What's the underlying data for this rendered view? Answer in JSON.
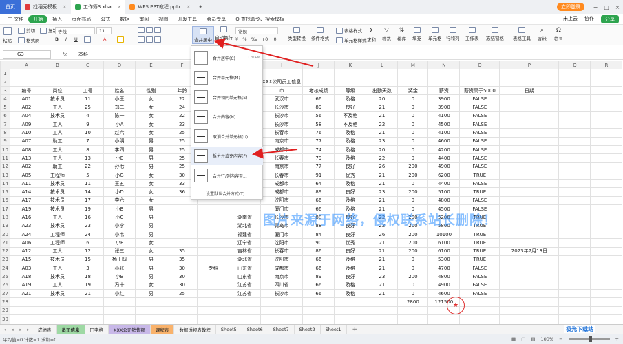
{
  "titlebar": {
    "tabs": [
      {
        "label": "首页",
        "kind": "home",
        "icon_color": ""
      },
      {
        "label": "找稻壳模板",
        "kind": "tab",
        "icon_color": "#e03a3a"
      },
      {
        "label": "工作簿3.xlsx",
        "kind": "active",
        "icon_color": "#2ea44f"
      },
      {
        "label": "WPS PPT教程.pptx",
        "kind": "tab",
        "icon_color": "#ff8a1e"
      }
    ],
    "login": "立即登录"
  },
  "menubar": {
    "items": [
      "三 文件",
      "开始",
      "插入",
      "页面布局",
      "公式",
      "数据",
      "审阅",
      "视图",
      "开发工具",
      "会员专享",
      "Q 查找命令、搜索模板"
    ],
    "right": [
      "未上云",
      "协作"
    ],
    "share": "分享"
  },
  "ribbon": {
    "cut": "剪切",
    "copy": "复制",
    "painter": "格式刷",
    "paste": "粘贴",
    "font": "等线",
    "size": "11",
    "merge": "合并居中",
    "wrap": "自动换行",
    "numfmt": "常规",
    "table_style": "表格样式",
    "cell_style": "单元格样式",
    "cond": "条件格式",
    "sum": "求和",
    "filter": "筛选",
    "sort": "排序",
    "fill": "填充",
    "cell": "单元格",
    "rowcol": "行和列",
    "sheet": "工作表",
    "freeze": "冻结窗格",
    "tabletools": "表格工具",
    "find": "查找",
    "symbol": "符号",
    "type_convert": "类型转换"
  },
  "formula": {
    "cell": "G3",
    "fx": "fx",
    "content": "本科"
  },
  "sheet": {
    "columns": [
      "A",
      "B",
      "C",
      "D",
      "E",
      "F",
      "G",
      "H",
      "I",
      "J",
      "K",
      "L",
      "M",
      "N",
      "O",
      "P",
      "Q",
      "R"
    ],
    "row2_title": "XXX公司员工信息",
    "headers": [
      "编号",
      "岗位",
      "工号",
      "姓名",
      "性别",
      "年龄",
      "",
      "",
      "市",
      "考核成绩",
      "等级",
      "出勤天数",
      "奖金",
      "薪资",
      "薪资高于5000",
      "日期"
    ],
    "rows": [
      [
        "A01",
        "技术员",
        "11",
        "小王",
        "女",
        "22",
        "",
        "",
        "武汉市",
        "66",
        "及格",
        "20",
        "0",
        "3900",
        "FALSE",
        ""
      ],
      [
        "A02",
        "工人",
        "25",
        "郑二",
        "女",
        "24",
        "",
        "",
        "长沙市",
        "89",
        "良好",
        "21",
        "0",
        "3900",
        "FALSE",
        ""
      ],
      [
        "A04",
        "技术员",
        "4",
        "陈一",
        "女",
        "22",
        "",
        "",
        "长沙市",
        "56",
        "不及格",
        "21",
        "0",
        "4100",
        "FALSE",
        ""
      ],
      [
        "A09",
        "工人",
        "9",
        "小A",
        "女",
        "23",
        "",
        "",
        "长沙市",
        "58",
        "不及格",
        "22",
        "0",
        "4500",
        "FALSE",
        ""
      ],
      [
        "A10",
        "工人",
        "10",
        "赵六",
        "女",
        "25",
        "",
        "",
        "长春市",
        "76",
        "及格",
        "21",
        "0",
        "4100",
        "FALSE",
        ""
      ],
      [
        "A07",
        "助工",
        "7",
        "小明",
        "男",
        "25",
        "",
        "",
        "南京市",
        "77",
        "及格",
        "23",
        "0",
        "4600",
        "FALSE",
        ""
      ],
      [
        "A08",
        "工人",
        "8",
        "李四",
        "男",
        "25",
        "",
        "",
        "成都市",
        "74",
        "及格",
        "20",
        "0",
        "4200",
        "FALSE",
        ""
      ],
      [
        "A13",
        "工人",
        "13",
        "小E",
        "男",
        "25",
        "",
        "",
        "长春市",
        "79",
        "及格",
        "22",
        "0",
        "4400",
        "FALSE",
        ""
      ],
      [
        "A02",
        "助工",
        "22",
        "孙七",
        "男",
        "25",
        "",
        "",
        "南京市",
        "77",
        "良好",
        "26",
        "200",
        "4900",
        "FALSE",
        ""
      ],
      [
        "A05",
        "工程师",
        "5",
        "小G",
        "女",
        "30",
        "",
        "",
        "长春市",
        "91",
        "优秀",
        "21",
        "200",
        "6200",
        "TRUE",
        ""
      ],
      [
        "A11",
        "技术员",
        "11",
        "王五",
        "女",
        "33",
        "",
        "",
        "成都市",
        "64",
        "及格",
        "21",
        "0",
        "4400",
        "FALSE",
        ""
      ],
      [
        "A14",
        "技术员",
        "14",
        "小D",
        "女",
        "36",
        "",
        "",
        "成都市",
        "89",
        "良好",
        "23",
        "200",
        "5100",
        "TRUE",
        ""
      ],
      [
        "A17",
        "技术员",
        "17",
        "李六",
        "女",
        "",
        "",
        "",
        "沈阳市",
        "66",
        "及格",
        "21",
        "0",
        "4800",
        "FALSE",
        ""
      ],
      [
        "A19",
        "技术员",
        "19",
        "小B",
        "男",
        "",
        "",
        "",
        "厦门市",
        "66",
        "及格",
        "21",
        "0",
        "4500",
        "FALSE",
        ""
      ],
      [
        "A16",
        "工人",
        "16",
        "小C",
        "男",
        "",
        "",
        "湖南省",
        "长沙市",
        "88",
        "良好",
        "22",
        "200",
        "5200",
        "TRUE",
        ""
      ],
      [
        "A23",
        "技术员",
        "23",
        "小李",
        "男",
        "",
        "",
        "湖北省",
        "青岛市",
        "88",
        "良好",
        "22",
        "200",
        "5800",
        "TRUE",
        ""
      ],
      [
        "A24",
        "工程师",
        "24",
        "小韦",
        "男",
        "",
        "",
        "福建省",
        "厦门市",
        "84",
        "良好",
        "26",
        "200",
        "10100",
        "TRUE",
        ""
      ],
      [
        "A06",
        "工程师",
        "6",
        "小F",
        "女",
        "",
        "",
        "辽宁省",
        "沈阳市",
        "90",
        "优秀",
        "21",
        "200",
        "6100",
        "TRUE",
        ""
      ],
      [
        "A12",
        "工人",
        "12",
        "张三",
        "女",
        "35",
        "",
        "吉林省",
        "长春市",
        "86",
        "良好",
        "21",
        "200",
        "6100",
        "TRUE",
        "2023年7月13日"
      ],
      [
        "A15",
        "技术员",
        "15",
        "杨十四",
        "男",
        "35",
        "",
        "湖北省",
        "沈阳市",
        "66",
        "及格",
        "21",
        "0",
        "5300",
        "TRUE",
        ""
      ],
      [
        "A03",
        "工人",
        "3",
        "小张",
        "男",
        "30",
        "专科",
        "山东省",
        "成都市",
        "66",
        "及格",
        "21",
        "0",
        "4700",
        "FALSE",
        ""
      ],
      [
        "A18",
        "技术员",
        "18",
        "小B",
        "男",
        "30",
        "",
        "山东省",
        "南京市",
        "89",
        "良好",
        "23",
        "200",
        "4800",
        "FALSE",
        ""
      ],
      [
        "A19",
        "工人",
        "19",
        "冯十",
        "女",
        "30",
        "",
        "江苏省",
        "四川省",
        "66",
        "及格",
        "21",
        "0",
        "4900",
        "FALSE",
        ""
      ],
      [
        "A21",
        "技术员",
        "21",
        "小红",
        "男",
        "25",
        "",
        "江苏省",
        "长沙市",
        "66",
        "及格",
        "21",
        "0",
        "4600",
        "FALSE",
        ""
      ],
      [
        "",
        "",
        "",
        "",
        "",
        "",
        "",
        "",
        "",
        "",
        "",
        "",
        "2800",
        "121500",
        "",
        ""
      ]
    ]
  },
  "dropdown": {
    "items": [
      {
        "label": "合并居中(C)",
        "shortcut": "Ctrl+M"
      },
      {
        "label": "合并单元格(M)",
        "shortcut": ""
      },
      {
        "label": "合并相同单元格(S)",
        "shortcut": ""
      },
      {
        "label": "合并内容(N)",
        "shortcut": ""
      },
      {
        "label": "取消合并单元格(U)",
        "shortcut": ""
      },
      {
        "label": "拆分并填充内容(F)",
        "shortcut": ""
      },
      {
        "label": "合并行/列内容至...",
        "shortcut": ""
      }
    ],
    "bottom": "设置默认合并方式(T)..."
  },
  "watermark": "图片来源于网络，侵权联系站长删除！",
  "stamp": "★",
  "sheettabs": {
    "tabs": [
      {
        "label": "成绩表",
        "color": ""
      },
      {
        "label": "员工信息",
        "color": "green"
      },
      {
        "label": "田字格",
        "color": ""
      },
      {
        "label": "XXX公司销售额",
        "color": "purple"
      },
      {
        "label": "课程表",
        "color": "orange"
      },
      {
        "label": "数据透视表教程",
        "color": ""
      },
      {
        "label": "Sheet5",
        "color": ""
      },
      {
        "label": "Sheet6",
        "color": ""
      },
      {
        "label": "Sheet7",
        "color": ""
      },
      {
        "label": "Sheet2",
        "color": ""
      },
      {
        "label": "Sheet1",
        "color": ""
      }
    ],
    "add": "+"
  },
  "statusbar": {
    "left": "平均值=0  计数=1  求和=0",
    "zoom": "100%"
  },
  "logo": "极光下载站"
}
